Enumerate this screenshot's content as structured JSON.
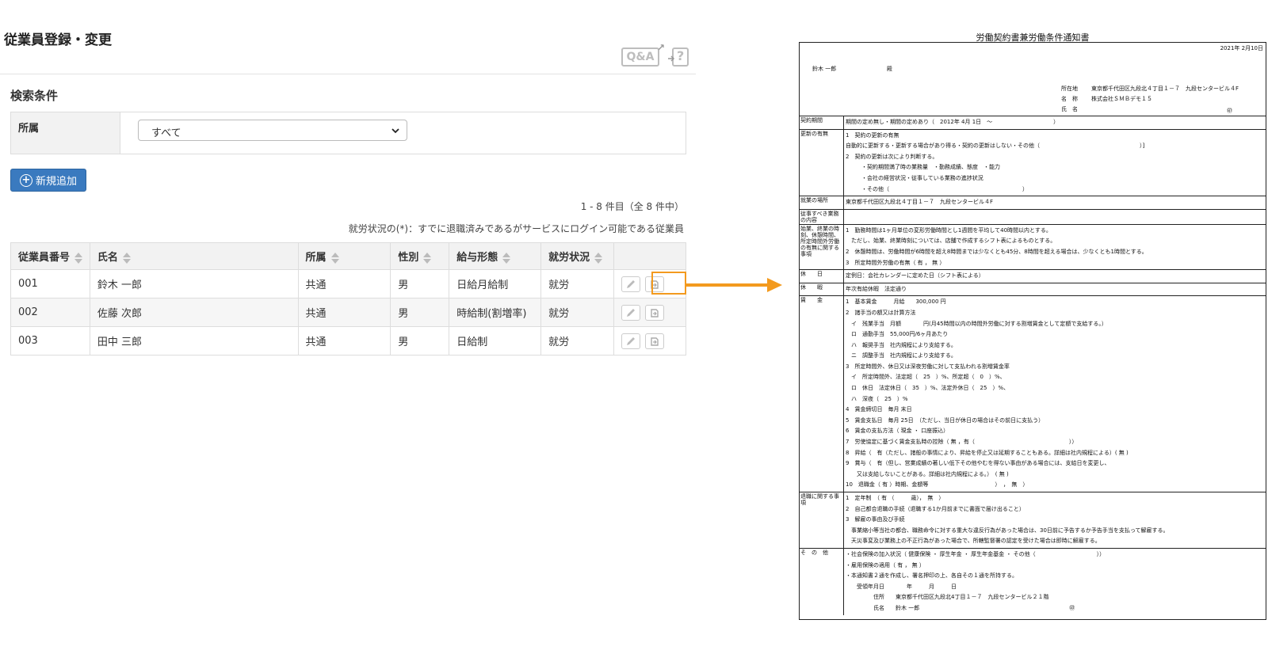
{
  "page_title": "従業員登録・変更",
  "help": {
    "qa_label": "Q&A",
    "qa_arrow": "↗",
    "help_label": "?"
  },
  "search": {
    "title": "検索条件",
    "field_label": "所属",
    "selected": "すべて"
  },
  "add_button": "新規追加",
  "count_text": "1 - 8 件目（全 8 件中）",
  "note_text": "就労状況の(*)：すでに退職済みであるがサービスにログイン可能である従業員",
  "table": {
    "headers": [
      "従業員番号",
      "氏名",
      "所属",
      "性別",
      "給与形態",
      "就労状況"
    ],
    "rows": [
      [
        "001",
        "鈴木 一郎",
        "共通",
        "男",
        "日給月給制",
        "就労"
      ],
      [
        "002",
        "佐藤 次郎",
        "共通",
        "男",
        "時給制(割増率)",
        "就労"
      ],
      [
        "003",
        "田中 三郎",
        "共通",
        "男",
        "日給制",
        "就労"
      ]
    ]
  },
  "icons": {
    "edit": "pencil-icon",
    "print": "document-export-icon"
  },
  "colors": {
    "accent": "#3a7abf",
    "highlight": "#f39a1e"
  },
  "document": {
    "title": "労働契約書兼労働条件通知書",
    "date": "2021年 2月10日",
    "to": "鈴木 一郎",
    "honorific": "殿",
    "emp_rows": [
      {
        "label": "所在地",
        "value": "東京都千代田区九段北４丁目１－７　九段センタービル４F"
      },
      {
        "label": "名　称",
        "value": "株式会社ＳＭＢデモ１５"
      },
      {
        "label": "氏　名",
        "value": ""
      }
    ],
    "seal": "㊞",
    "sections": [
      {
        "label": "契約期間",
        "lines": [
          "期間の定め無し・期間の定めあり（　2012年 4月 1日　～　　　　　　　　　　　）"
        ]
      },
      {
        "label": "更新の有無",
        "lines": [
          "1　契約の更新の有無",
          "自動的に更新する・更新する場合があり得る・契約の更新はしない・その他（　　　　　　　　　　　　　　　　　　）]",
          "2　契約の更新は次により判断する。",
          "・契約期間満了時の業務量　・勤務成績、態度　・能力",
          "・会社の経営状況・従事している業務の進捗状況",
          "・その他（　　　　　　　　　　　　　　　　　　　　　　　　）"
        ]
      },
      {
        "label": "就業の場所",
        "lines": [
          "東京都千代田区九段北４丁目１－７　九段センタービル４F"
        ]
      },
      {
        "label": "従事すべき業務の内容",
        "lines": [
          ""
        ]
      },
      {
        "label": "始業、終業の時刻、休憩時間、所定時間外労働の有無に関する事項",
        "lines": [
          "1　勤務時間は1ヶ月単位の変形労働時間とし1週間を平均して40時間以内とする。",
          "　ただし、始業、終業時刻については、店舗で作成するシフト表によるものとする。",
          "2　休憩時間は、労働時間が6時間を超え8時間までは少なくとも45分、8時間を超える場合は、少なくとも1時間とする。",
          "3　所定時間外労働の有無（ 有 ， 無 ）"
        ]
      },
      {
        "label": "休　　日",
        "lines": [
          "定例日：会社カレンダーに定めた日（シフト表による）"
        ]
      },
      {
        "label": "休　　暇",
        "lines": [
          "年次有給休暇　法定通り"
        ]
      },
      {
        "label": "賃　　金",
        "lines": [
          "1　基本賃金　　　月給　　300,000 円",
          "2　諸手当の額又は計算方法",
          "　イ　残業手当　月額　　　　円(月45時間以内の時間外労働に対する割増賃金として定額で支給する。）",
          "　ロ　通勤手当　55,000円/6ヶ月あたり",
          "　ハ　報奨手当　社内規程により支給する。",
          "　ニ　調整手当　社内規程により支給する。",
          "3　所定時間外、休日又は深夜労働に対して支払われる割増賃金率",
          "　イ　所定時間外、法定超（　25　）%、所定超（　0　）%、",
          "　ロ　休日　法定休日（　35　）%、法定外休日（　25　）%、",
          "　ハ　深夜（　25　）%",
          "4　賃金締切日　毎月 末日",
          "5　賃金支払日　毎月 25日　（ただし、当日が休日の場合はその前日に支払う）",
          "6　賃金の支払方法（ 現金 ・ 口座振込）",
          "7　労使協定に基づく賃金支払時の控除（ 無 ，有（　　　　　　　　　　　　　　　　　））",
          "8　昇給（　有（ただし、諸般の事情により、昇給を停止又は延期することもある。詳細は社内規程による）( 無 )",
          "9　賞与（　有（但し、営業成績の著しい低下その他やむを得ない事由がある場合には、支給日を変更し、",
          "　　又は支給しないことがある。詳細は社内規程による。）　( 無 )",
          "10　退職金（ 有 ）時期、金額等　　　　　　　　　　　　）　，　無　）"
        ]
      },
      {
        "label": "退職に関する事項",
        "lines": [
          "1　定年制　（ 有 （　　　歳），　無　）",
          "2　自己都合退職の手続（退職する1か月前までに書面で届け出ること）",
          "3　解雇の事由及び手続",
          "　事業縮小等当社の都合、職務命令に対する重大な違反行為があった場合は、30日前に予告するか予告手当を支払って解雇する。",
          "　天災事変及び業務上の不正行為があった場合で、所轄監督署の認定を受けた場合は即時に解雇する。"
        ]
      },
      {
        "label": "そ　の　他",
        "lines": [
          "・社会保険の加入状況（ 健康保険 ・ 厚生年金 ・ 厚生年金基金 ・ その他（　　　　　　　　　　　））",
          "・雇用保険の適用（ 有 ， 無 ）",
          "・本通知書２通を作成し、署名押印の上、各自その１通を所持する。",
          "　　受領年月日　　　　年　　　月　　　日",
          "　　　　　住所　　東京都千代田区九段北4丁目１－７　九段センタービル２１階",
          "　　　　　氏名　　鈴木 一郎　　　　　　　　　　　　　　　　　　　　　　　　　　　㊞"
        ]
      }
    ]
  }
}
